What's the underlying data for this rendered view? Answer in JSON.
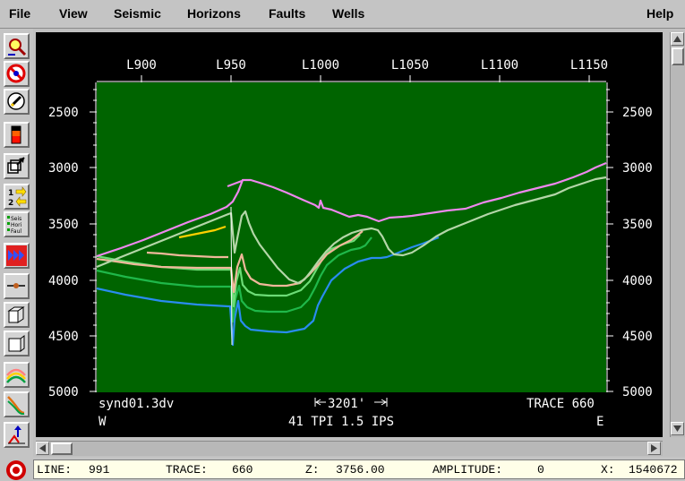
{
  "menu": {
    "items": [
      {
        "label": "File"
      },
      {
        "label": "View"
      },
      {
        "label": "Seismic"
      },
      {
        "label": "Horizons"
      },
      {
        "label": "Faults"
      },
      {
        "label": "Wells"
      }
    ],
    "help": "Help"
  },
  "toolbar": {
    "tools": [
      {
        "icon": "zoom-icon"
      },
      {
        "icon": "no-entry-icon"
      },
      {
        "icon": "pencil-icon"
      },
      {
        "icon": "color-bar-icon"
      },
      {
        "icon": "resize-icon"
      },
      {
        "icon": "swap-order-icon",
        "text1": "1",
        "text2": "2"
      },
      {
        "icon": "layers-list-icon",
        "lines": [
          "Seis",
          "Hori",
          "Faul"
        ]
      },
      {
        "icon": "fast-forward-icon"
      },
      {
        "icon": "pick-line-icon"
      },
      {
        "icon": "cube-open-icon"
      },
      {
        "icon": "cube-icon"
      },
      {
        "icon": "horizon-arcs-icon"
      },
      {
        "icon": "fault-lines-icon"
      },
      {
        "icon": "well-arrow-icon"
      }
    ]
  },
  "section": {
    "top_axis_labels": [
      "L900",
      "L950",
      "L1000",
      "L1050",
      "L1100",
      "L1150"
    ],
    "depth_labels": [
      "2500",
      "3000",
      "3500",
      "4000",
      "4500",
      "5000"
    ],
    "file_name": "synd01.3dv",
    "scale_bar": "3201'",
    "trace_label": "TRACE 660",
    "west_label": "W",
    "east_label": "E",
    "scale_info": "41 TPI 1.5 IPS",
    "background_color": "#006400"
  },
  "status": {
    "line_label": "LINE:",
    "line_value": "991",
    "trace_label": "TRACE:",
    "trace_value": "660",
    "z_label": "Z:",
    "z_value": "3756.00",
    "amplitude_label": "AMPLITUDE:",
    "amplitude_value": "0",
    "x_label": "X:",
    "x_value": "1540672"
  }
}
